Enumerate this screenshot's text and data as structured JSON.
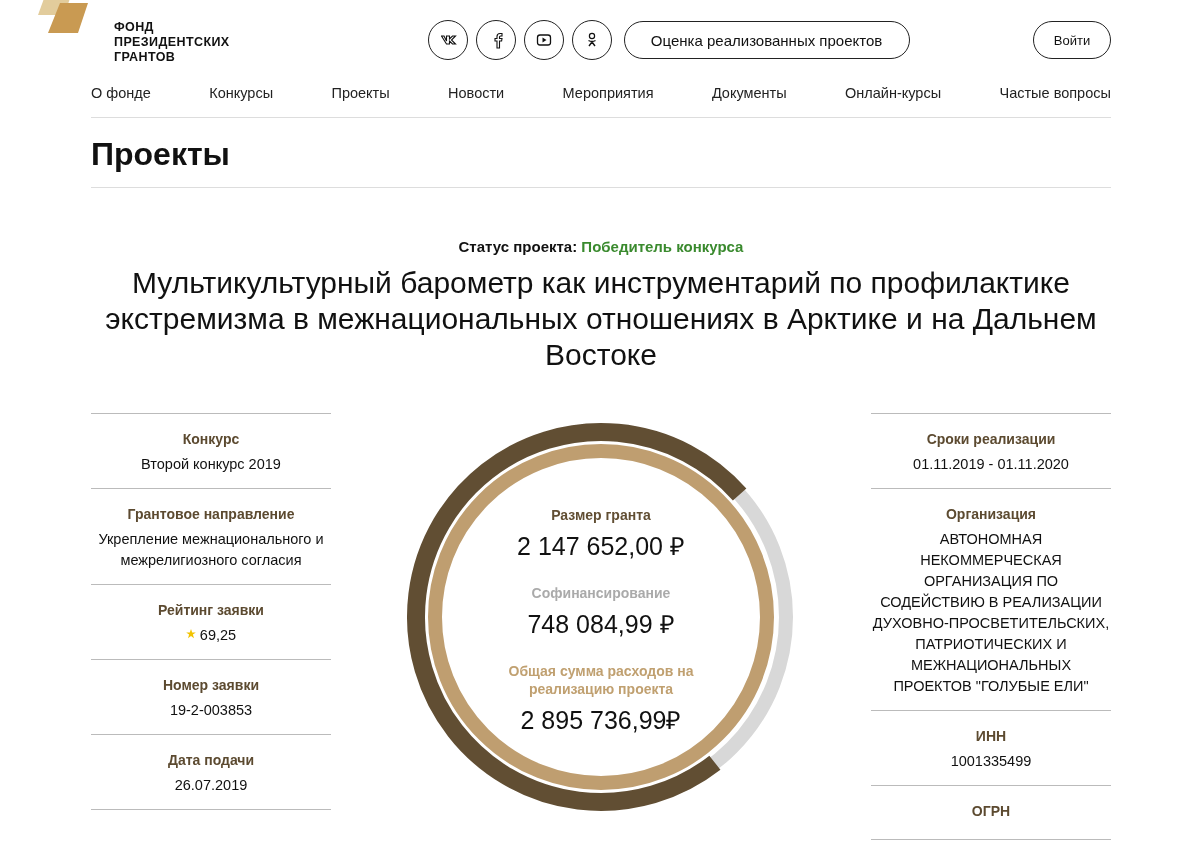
{
  "logo": {
    "lines": [
      "ФОНД",
      "ПРЕЗИДЕНТСКИХ",
      "ГРАНТОВ"
    ]
  },
  "header": {
    "evaluation_button": "Оценка реализованных проектов",
    "login_button": "Войти"
  },
  "social": [
    {
      "kind": "vk"
    },
    {
      "kind": "facebook"
    },
    {
      "kind": "youtube"
    },
    {
      "kind": "ok"
    }
  ],
  "nav": [
    "О фонде",
    "Конкурсы",
    "Проекты",
    "Новости",
    "Мероприятия",
    "Документы",
    "Онлайн-курсы",
    "Частые вопросы"
  ],
  "page_title": "Проекты",
  "status": {
    "label": "Статус проекта:",
    "value": "Победитель конкурса"
  },
  "project_title": "Мультикультурный барометр как инструментарий по профилактике экстремизма в межнациональных отношениях в Арктике и на Дальнем Востоке",
  "left_info": [
    {
      "label": "Конкурс",
      "value": "Второй конкурс 2019"
    },
    {
      "label": "Грантовое направление",
      "value": "Укрепление межнационального и межрелигиозного согласия"
    },
    {
      "label": "Рейтинг заявки",
      "value": "69,25",
      "kind": "rating"
    },
    {
      "label": "Номер заявки",
      "value": "19-2-003853"
    },
    {
      "label": "Дата подачи",
      "value": "26.07.2019"
    }
  ],
  "finance": {
    "level": 0.74,
    "items": [
      {
        "label": "Размер гранта",
        "value": "2 147 652,00 ₽",
        "color": "#614e33"
      },
      {
        "label": "Софинансирование",
        "value": "748 084,99 ₽",
        "color": "#aaaaaa"
      },
      {
        "label": "Общая сумма расходов на реализацию проекта",
        "value": "2 895 736,99₽",
        "color": "#c0a070"
      }
    ]
  },
  "right_info": [
    {
      "label": "Сроки реализации",
      "value": "01.11.2019 - 01.11.2020"
    },
    {
      "label": "Организация",
      "value": "АВТОНОМНАЯ НЕКОММЕРЧЕСКАЯ ОРГАНИЗАЦИЯ ПО СОДЕЙСТВИЮ В РЕАЛИЗАЦИИ ДУХОВНО-ПРОСВЕТИТЕЛЬСКИХ, ПАТРИОТИЧЕСКИХ И МЕЖНАЦИОНАЛЬНЫХ ПРОЕКТОВ \"ГОЛУБЫЕ ЕЛИ\""
    },
    {
      "label": "ИНН",
      "value": "1001335499"
    },
    {
      "label": "ОГРН"
    }
  ]
}
